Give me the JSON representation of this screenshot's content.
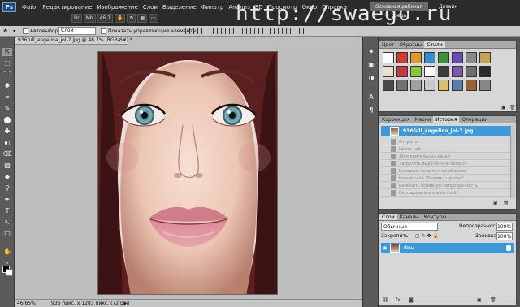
{
  "app": {
    "logo_text": "Ps",
    "workspace_label": "Основная рабочая среда",
    "design_label": "Дизайн",
    "watermark": "http://swaego.ru",
    "zoom_badge": "46,7"
  },
  "menu": [
    "Файл",
    "Редактирование",
    "Изображение",
    "Слои",
    "Выделение",
    "Фильтр",
    "Анализ",
    "3D",
    "Просмотр",
    "Окно",
    "Справка"
  ],
  "options": {
    "autoselect_label": "Автовыбор:",
    "autoselect_value": "Слой",
    "show_controls_label": "Показать управляющие элементы"
  },
  "document": {
    "tab_title": "936full_angelina_jol-7.jpg @ 46,7% (RGB/8#) *",
    "zoom": "46,65%",
    "doc_info": "936 пикс. x 1283 пикс. (72 ppi)"
  },
  "swatches_panel": {
    "tabs": [
      {
        "label": "Цвет",
        "on": false
      },
      {
        "label": "Образцы",
        "on": false
      },
      {
        "label": "Стили",
        "on": true
      }
    ],
    "swatch_colors": [
      "#ffffff",
      "#d63a2f",
      "#e09a2c",
      "#2f8fd1",
      "#3f8f3f",
      "#6a4bb0",
      "#8a8a8a",
      "#c8a44a",
      "#e8e0d0",
      "#c23a3a",
      "#8cc63f",
      "#ffffff",
      "#3b3b3b",
      "#7a5aa8",
      "#6e6e6e",
      "#2b2b2b",
      "#4a4a4a",
      "#707070",
      "#a0a0a0",
      "#c8c8c8",
      "#d8c070",
      "#5a7ab0",
      "#9a6030",
      "#888888"
    ]
  },
  "history_panel": {
    "tabs": [
      {
        "label": "Коррекция",
        "on": false
      },
      {
        "label": "Маски",
        "on": false
      },
      {
        "label": "История",
        "on": true
      },
      {
        "label": "Операции",
        "on": false
      }
    ],
    "source": "936full_angelina_jol-7.jpg",
    "steps": [
      "Открыть",
      "Цвета Lab",
      "Дополнительный канал",
      "Загрузить выделенную область",
      "Инверсия выделенной области",
      "Новый слой \"Заливка цветом\"",
      "Изменить основную непрозрачность",
      "Скопировать в новый слой"
    ]
  },
  "layers_panel": {
    "tabs": [
      {
        "label": "Слои",
        "on": true
      },
      {
        "label": "Каналы",
        "on": false
      },
      {
        "label": "Контуры",
        "on": false
      }
    ],
    "blend_mode": "Обычные",
    "opacity_label": "Непрозрачность:",
    "opacity": "100%",
    "lock_label": "Закрепить:",
    "fill_label": "Заливка:",
    "fill": "100%",
    "layer_name": "Фон"
  },
  "toolbox": [
    "⇱",
    "⬚",
    "⌒",
    "✱",
    "⌗",
    "✎",
    "⬤",
    "✚",
    "◐",
    "⌫",
    "▨",
    "◆",
    "⚲",
    "✒",
    "T",
    "↖",
    "□",
    "✋",
    "⚬"
  ],
  "iconstrip": [
    "✷",
    "▣",
    "◑",
    "A",
    "¶"
  ]
}
